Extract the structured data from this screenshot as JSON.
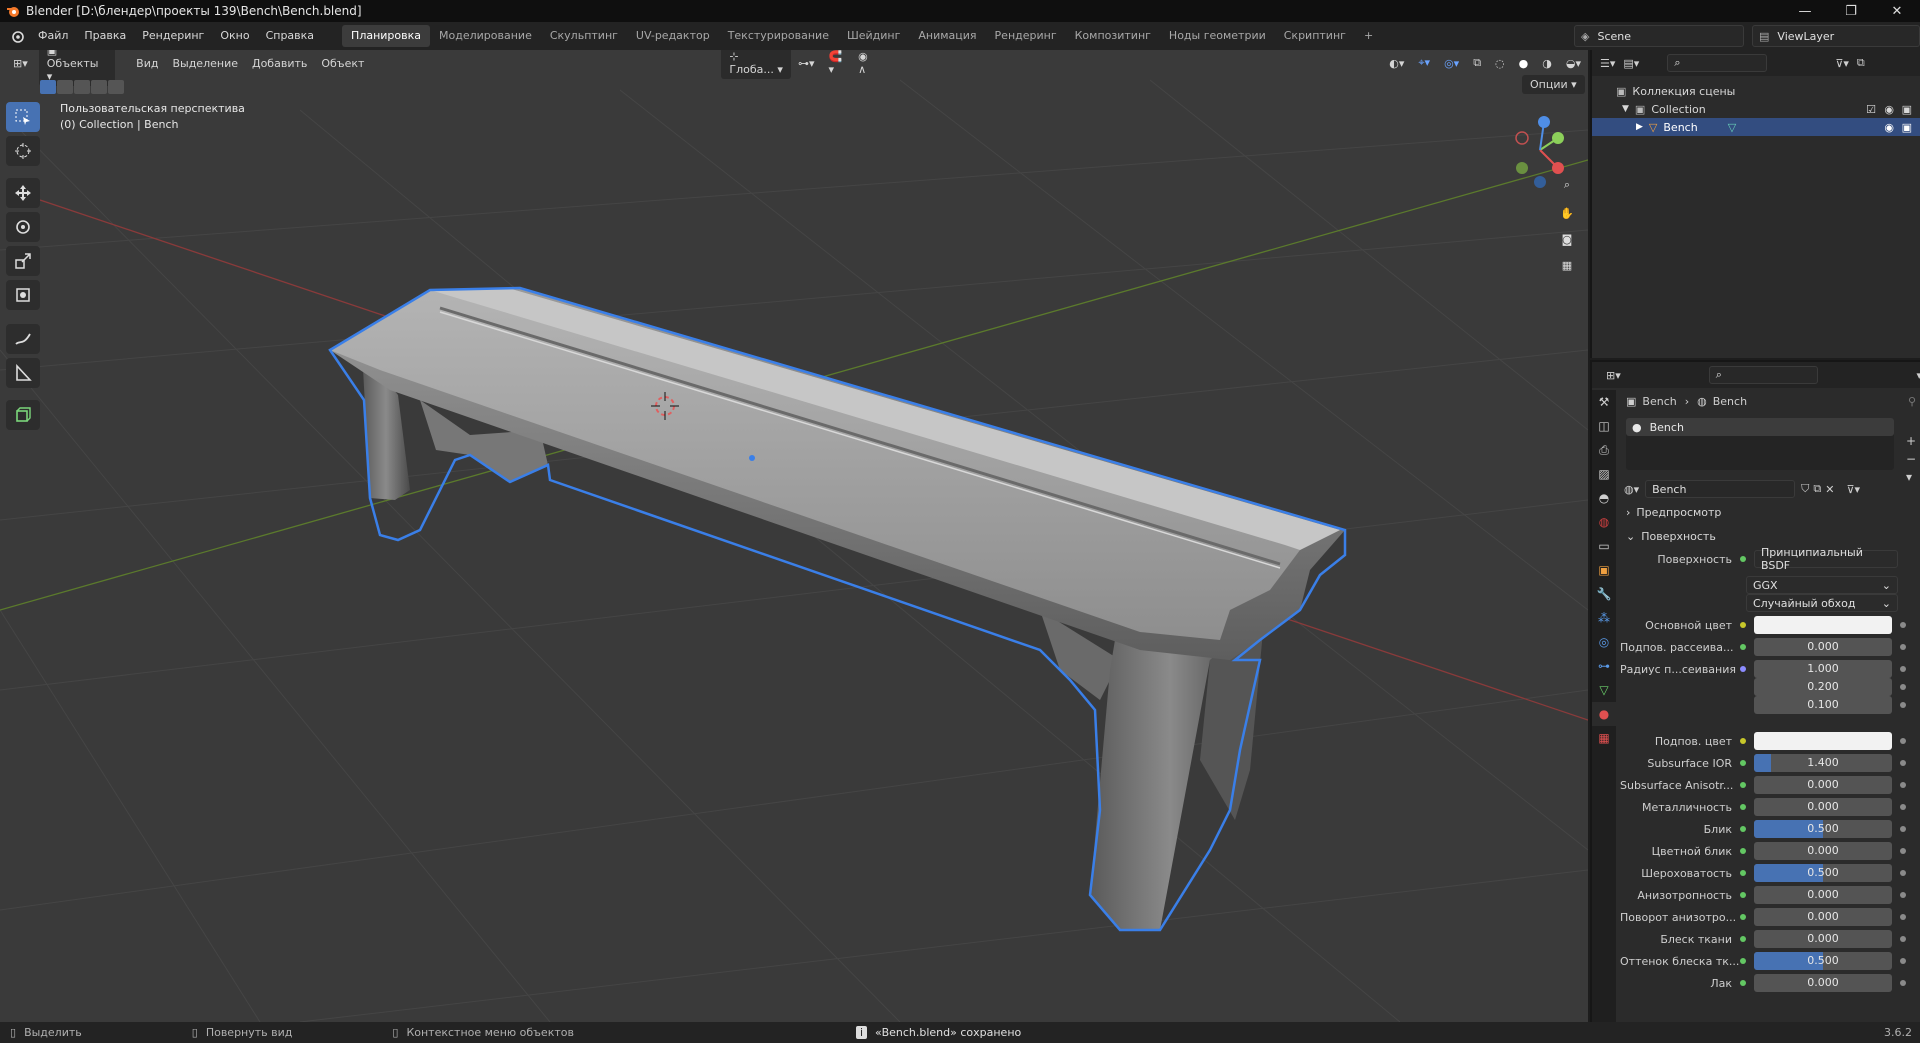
{
  "window": {
    "title": "Blender [D:\\блендер\\проекты 139\\Bench\\Bench.blend]",
    "controls": [
      "—",
      "❐",
      "✕"
    ]
  },
  "menu": [
    "Файл",
    "Правка",
    "Рендеринг",
    "Окно",
    "Справка"
  ],
  "workspaces": [
    "Планировка",
    "Моделирование",
    "Скульптинг",
    "UV-редактор",
    "Текстурирование",
    "Шейдинг",
    "Анимация",
    "Рендеринг",
    "Композитинг",
    "Ноды геометрии",
    "Скриптинг",
    "+"
  ],
  "active_workspace": "Планировка",
  "scene": {
    "name": "Scene",
    "view_layer": "ViewLayer"
  },
  "viewport": {
    "mode": "Объекты",
    "menu": [
      "Вид",
      "Выделение",
      "Добавить",
      "Объект"
    ],
    "transform": "Глоба...",
    "options": "Опции",
    "view_name": "Пользовательская перспектива",
    "collection_info": "(0) Collection | Bench"
  },
  "outliner": {
    "scene_collection": "Коллекция сцены",
    "collection": "Collection",
    "object": "Bench"
  },
  "properties": {
    "breadcrumb": [
      "Bench",
      "Bench"
    ],
    "material_slot": "Bench",
    "material_name": "Bench",
    "sections": {
      "preview": "Предпросмотр",
      "surface": "Поверхность"
    },
    "surface_label": "Поверхность",
    "surface_value": "Принципиальный BSDF",
    "distribution": "GGX",
    "subsurface_method": "Случайный обход",
    "rows": [
      {
        "label": "Основной цвет",
        "value": "",
        "type": "color",
        "dot": "y"
      },
      {
        "label": "Подпов. рассеива...",
        "value": "0.000",
        "fill": 0,
        "dot": "g"
      },
      {
        "label": "Радиус п...сеивания",
        "value": "1.000",
        "fill": 0,
        "dot": "p"
      },
      {
        "label": "",
        "value": "0.200",
        "fill": 0,
        "dot": ""
      },
      {
        "label": "",
        "value": "0.100",
        "fill": 0,
        "dot": ""
      },
      {
        "label": "Подпов. цвет",
        "value": "",
        "type": "color",
        "dot": "y"
      },
      {
        "label": "Subsurface IOR",
        "value": "1.400",
        "fill": 0.12,
        "dot": "g"
      },
      {
        "label": "Subsurface Anisotr...",
        "value": "0.000",
        "fill": 0,
        "dot": "g"
      },
      {
        "label": "Металличность",
        "value": "0.000",
        "fill": 0,
        "dot": "g"
      },
      {
        "label": "Блик",
        "value": "0.500",
        "fill": 0.5,
        "dot": "g"
      },
      {
        "label": "Цветной блик",
        "value": "0.000",
        "fill": 0,
        "dot": "g"
      },
      {
        "label": "Шероховатость",
        "value": "0.500",
        "fill": 0.5,
        "dot": "g"
      },
      {
        "label": "Анизотропность",
        "value": "0.000",
        "fill": 0,
        "dot": "g"
      },
      {
        "label": "Поворот анизотро...",
        "value": "0.000",
        "fill": 0,
        "dot": "g"
      },
      {
        "label": "Блеск ткани",
        "value": "0.000",
        "fill": 0,
        "dot": "g"
      },
      {
        "label": "Оттенок блеска тк...",
        "value": "0.500",
        "fill": 0.5,
        "dot": "g"
      },
      {
        "label": "Лак",
        "value": "0.000",
        "fill": 0,
        "dot": "g"
      }
    ]
  },
  "status": {
    "select": "Выделить",
    "rotate": "Повернуть вид",
    "context": "Контекстное меню объектов",
    "message": "«Bench.blend» сохранено",
    "version": "3.6.2"
  }
}
